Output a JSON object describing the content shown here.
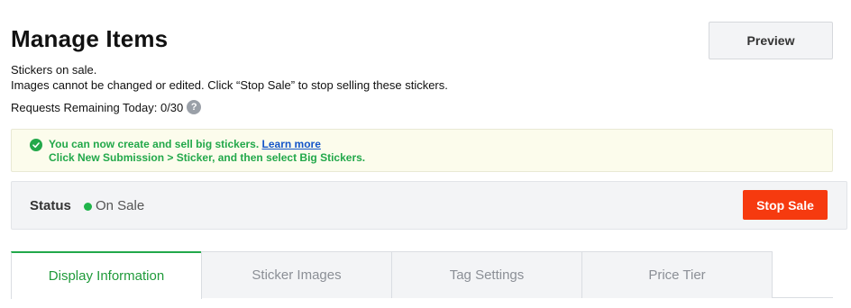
{
  "page": {
    "title": "Manage Items",
    "preview_label": "Preview"
  },
  "description": {
    "line1": "Stickers on sale.",
    "line2": "Images cannot be changed or edited. Click “Stop Sale” to stop selling these stickers."
  },
  "requests": {
    "label": "Requests Remaining Today: 0/30",
    "help_icon": "?"
  },
  "notice": {
    "line1_text": "You can now create and sell big stickers.",
    "link_text": "Learn more",
    "line2_text": "Click New Submission > Sticker, and then select Big Stickers.",
    "color": "#22a84a"
  },
  "status": {
    "label": "Status",
    "value": "On Sale",
    "dot_color": "#20b44a",
    "stop_label": "Stop Sale",
    "stop_color": "#f63a0f"
  },
  "tabs": [
    {
      "label": "Display Information",
      "active": true
    },
    {
      "label": "Sticker Images",
      "active": false
    },
    {
      "label": "Tag Settings",
      "active": false
    },
    {
      "label": "Price Tier",
      "active": false
    }
  ]
}
